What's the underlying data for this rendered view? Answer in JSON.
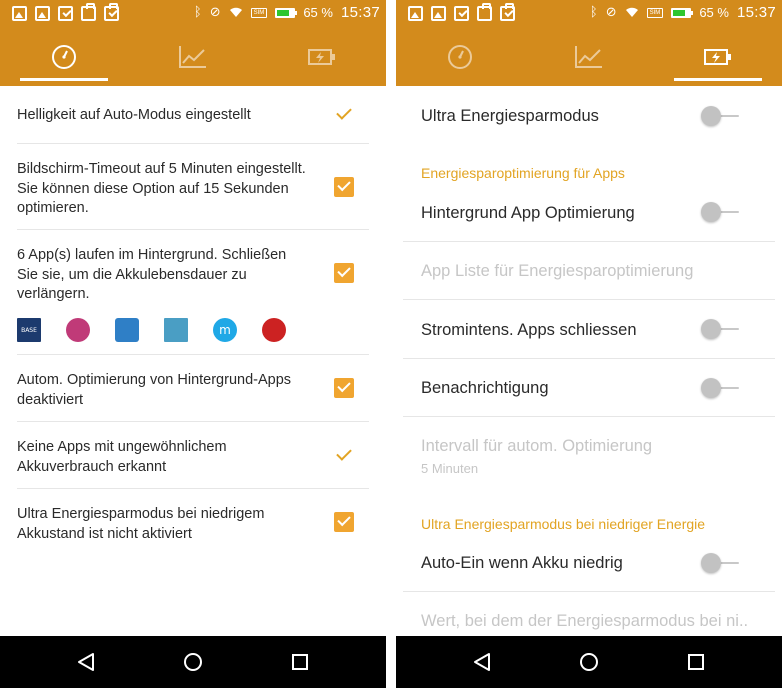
{
  "status_bar": {
    "battery_percent": "65 %",
    "time": "15:37",
    "sim_label": "SIM",
    "battery_color": "#2ec62e"
  },
  "colors": {
    "accent": "#d38b1c",
    "check": "#f0a530",
    "section_header": "#e2a423"
  },
  "tabs": [
    {
      "icon": "speedometer-icon"
    },
    {
      "icon": "chart-line-icon"
    },
    {
      "icon": "battery-charging-icon"
    }
  ],
  "left_screen": {
    "active_tab": 0,
    "items": [
      {
        "text": "Helligkeit auf Auto-Modus eingestellt",
        "mark": "tick"
      },
      {
        "text": "Bildschirm-Timeout auf 5 Minuten eingestellt. Sie können diese Option auf 15 Sekunden optimieren.",
        "mark": "checkbox"
      },
      {
        "text": "6 App(s) laufen im Hintergrund. Schließen Sie sie, um die Akkulebensdauer zu verlängern.",
        "mark": "checkbox",
        "app_icons": [
          "base-app-icon",
          "pink-bird-app-icon",
          "blue-square-app-icon",
          "chart-app-icon",
          "m-circle-app-icon",
          "red-beast-app-icon"
        ],
        "app_icon_texts": [
          "BASE",
          "m"
        ]
      },
      {
        "text": "Autom. Optimierung von Hintergrund-Apps deaktiviert",
        "mark": "checkbox"
      },
      {
        "text": "Keine Apps mit ungewöhnlichem Akkuverbrauch erkannt",
        "mark": "tick"
      },
      {
        "text": "Ultra Energiesparmodus bei niedrigem Akkustand ist nicht aktiviert",
        "mark": "checkbox"
      }
    ]
  },
  "right_screen": {
    "active_tab": 2,
    "ultra_mode": {
      "label": "Ultra Energiesparmodus",
      "enabled": false
    },
    "section_app_optimization": "Energiesparoptimierung für Apps",
    "background_optimization": {
      "label": "Hintergrund App Optimierung",
      "enabled": false
    },
    "app_list": {
      "label": "App Liste für Energiesparoptimierung"
    },
    "close_power_apps": {
      "label": "Stromintens. Apps schliessen",
      "enabled": false
    },
    "notification": {
      "label": "Benachrichtigung",
      "enabled": false
    },
    "interval": {
      "label": "Intervall für autom. Optimierung",
      "value": "5 Minuten"
    },
    "section_ultra_low": "Ultra Energiesparmodus bei niedriger Energie",
    "auto_on": {
      "label": "Auto-Ein wenn Akku niedrig",
      "enabled": false
    },
    "threshold": {
      "label": "Wert, bei dem der Energiesparmodus bei ni.."
    }
  },
  "nav_bar": {
    "back": "back-triangle-icon",
    "home": "home-circle-icon",
    "recents": "recents-square-icon"
  }
}
